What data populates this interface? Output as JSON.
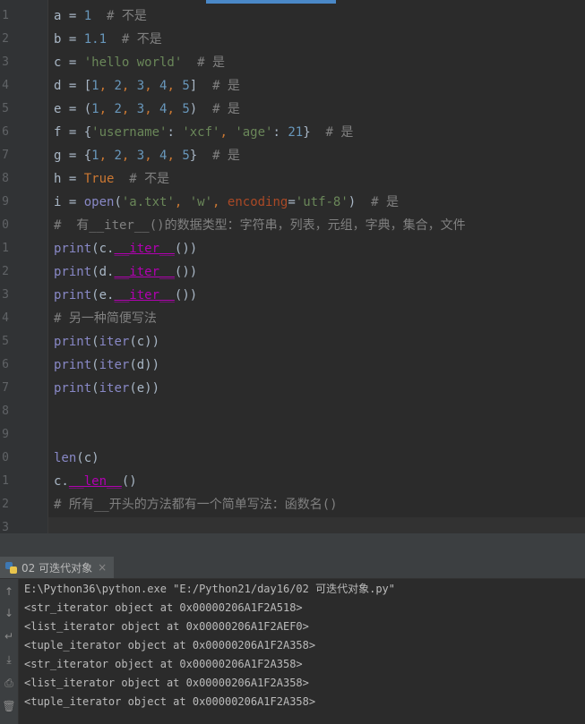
{
  "editor": {
    "lines": [
      {
        "n": "1",
        "segs": [
          {
            "t": "a = ",
            "c": ""
          },
          {
            "t": "1",
            "c": "num"
          },
          {
            "t": "  # 不是",
            "c": "com"
          }
        ]
      },
      {
        "n": "2",
        "segs": [
          {
            "t": "b = ",
            "c": ""
          },
          {
            "t": "1.1",
            "c": "num"
          },
          {
            "t": "  # 不是",
            "c": "com"
          }
        ]
      },
      {
        "n": "3",
        "segs": [
          {
            "t": "c = ",
            "c": ""
          },
          {
            "t": "'hello world'",
            "c": "str"
          },
          {
            "t": "  # 是",
            "c": "com"
          }
        ]
      },
      {
        "n": "4",
        "segs": [
          {
            "t": "d = [",
            "c": ""
          },
          {
            "t": "1",
            "c": "num"
          },
          {
            "t": ", ",
            "c": "kw"
          },
          {
            "t": "2",
            "c": "num"
          },
          {
            "t": ", ",
            "c": "kw"
          },
          {
            "t": "3",
            "c": "num"
          },
          {
            "t": ", ",
            "c": "kw"
          },
          {
            "t": "4",
            "c": "num"
          },
          {
            "t": ", ",
            "c": "kw"
          },
          {
            "t": "5",
            "c": "num"
          },
          {
            "t": "]  ",
            "c": ""
          },
          {
            "t": "# 是",
            "c": "com"
          }
        ]
      },
      {
        "n": "5",
        "segs": [
          {
            "t": "e = (",
            "c": ""
          },
          {
            "t": "1",
            "c": "num"
          },
          {
            "t": ", ",
            "c": "kw"
          },
          {
            "t": "2",
            "c": "num"
          },
          {
            "t": ", ",
            "c": "kw"
          },
          {
            "t": "3",
            "c": "num"
          },
          {
            "t": ", ",
            "c": "kw"
          },
          {
            "t": "4",
            "c": "num"
          },
          {
            "t": ", ",
            "c": "kw"
          },
          {
            "t": "5",
            "c": "num"
          },
          {
            "t": ")  ",
            "c": ""
          },
          {
            "t": "# 是",
            "c": "com"
          }
        ]
      },
      {
        "n": "6",
        "segs": [
          {
            "t": "f = {",
            "c": ""
          },
          {
            "t": "'username'",
            "c": "str"
          },
          {
            "t": ": ",
            "c": ""
          },
          {
            "t": "'xcf'",
            "c": "str"
          },
          {
            "t": ", ",
            "c": "kw"
          },
          {
            "t": "'age'",
            "c": "str"
          },
          {
            "t": ": ",
            "c": ""
          },
          {
            "t": "21",
            "c": "num"
          },
          {
            "t": "}  ",
            "c": ""
          },
          {
            "t": "# 是",
            "c": "com"
          }
        ]
      },
      {
        "n": "7",
        "segs": [
          {
            "t": "g = {",
            "c": ""
          },
          {
            "t": "1",
            "c": "num"
          },
          {
            "t": ", ",
            "c": "kw"
          },
          {
            "t": "2",
            "c": "num"
          },
          {
            "t": ", ",
            "c": "kw"
          },
          {
            "t": "3",
            "c": "num"
          },
          {
            "t": ", ",
            "c": "kw"
          },
          {
            "t": "4",
            "c": "num"
          },
          {
            "t": ", ",
            "c": "kw"
          },
          {
            "t": "5",
            "c": "num"
          },
          {
            "t": "}  ",
            "c": ""
          },
          {
            "t": "# 是",
            "c": "com"
          }
        ]
      },
      {
        "n": "8",
        "segs": [
          {
            "t": "h = ",
            "c": ""
          },
          {
            "t": "True",
            "c": "kw"
          },
          {
            "t": "  # 不是",
            "c": "com"
          }
        ]
      },
      {
        "n": "9",
        "segs": [
          {
            "t": "i = ",
            "c": ""
          },
          {
            "t": "open",
            "c": "bi"
          },
          {
            "t": "(",
            "c": ""
          },
          {
            "t": "'a.txt'",
            "c": "str"
          },
          {
            "t": ", ",
            "c": "kw"
          },
          {
            "t": "'w'",
            "c": "str"
          },
          {
            "t": ", ",
            "c": "kw"
          },
          {
            "t": "encoding",
            "c": "param"
          },
          {
            "t": "=",
            "c": ""
          },
          {
            "t": "'utf-8'",
            "c": "str"
          },
          {
            "t": ")  ",
            "c": ""
          },
          {
            "t": "# 是",
            "c": "com"
          }
        ]
      },
      {
        "n": "0",
        "segs": [
          {
            "t": "#  有__iter__()的数据类型：字符串，列表，元组，字典，集合，文件",
            "c": "com"
          }
        ]
      },
      {
        "n": "1",
        "segs": [
          {
            "t": "print",
            "c": "bi"
          },
          {
            "t": "(c.",
            "c": ""
          },
          {
            "t": "__iter__",
            "c": "dun"
          },
          {
            "t": "())",
            "c": ""
          }
        ]
      },
      {
        "n": "2",
        "segs": [
          {
            "t": "print",
            "c": "bi"
          },
          {
            "t": "(d.",
            "c": ""
          },
          {
            "t": "__iter__",
            "c": "dun"
          },
          {
            "t": "())",
            "c": ""
          }
        ]
      },
      {
        "n": "3",
        "segs": [
          {
            "t": "print",
            "c": "bi"
          },
          {
            "t": "(e.",
            "c": ""
          },
          {
            "t": "__iter__",
            "c": "dun"
          },
          {
            "t": "())",
            "c": ""
          }
        ]
      },
      {
        "n": "4",
        "segs": [
          {
            "t": "# 另一种简便写法",
            "c": "com"
          }
        ]
      },
      {
        "n": "5",
        "segs": [
          {
            "t": "print",
            "c": "bi"
          },
          {
            "t": "(",
            "c": ""
          },
          {
            "t": "iter",
            "c": "bi"
          },
          {
            "t": "(c))",
            "c": ""
          }
        ]
      },
      {
        "n": "6",
        "segs": [
          {
            "t": "print",
            "c": "bi"
          },
          {
            "t": "(",
            "c": ""
          },
          {
            "t": "iter",
            "c": "bi"
          },
          {
            "t": "(d))",
            "c": ""
          }
        ]
      },
      {
        "n": "7",
        "segs": [
          {
            "t": "print",
            "c": "bi"
          },
          {
            "t": "(",
            "c": ""
          },
          {
            "t": "iter",
            "c": "bi"
          },
          {
            "t": "(e))",
            "c": ""
          }
        ]
      },
      {
        "n": "8",
        "segs": []
      },
      {
        "n": "9",
        "segs": []
      },
      {
        "n": "0",
        "segs": [
          {
            "t": "len",
            "c": "bi"
          },
          {
            "t": "(c)",
            "c": ""
          }
        ]
      },
      {
        "n": "1",
        "segs": [
          {
            "t": "c.",
            "c": ""
          },
          {
            "t": "__len__",
            "c": "dun"
          },
          {
            "t": "()",
            "c": ""
          }
        ]
      },
      {
        "n": "2",
        "segs": [
          {
            "t": "# 所有__开头的方法都有一个简单写法：函数名()",
            "c": "com"
          }
        ]
      },
      {
        "n": "3",
        "segs": []
      }
    ]
  },
  "run": {
    "tab_label": "02 可迭代对象",
    "close_icon": "×",
    "toolbar_icons": [
      "↑",
      "↓",
      "↵",
      "⤓",
      "⎙",
      "🗑"
    ],
    "output": [
      "E:\\Python36\\python.exe \"E:/Python21/day16/02 可迭代对象.py\"",
      "<str_iterator object at 0x00000206A1F2A518>",
      "<list_iterator object at 0x00000206A1F2AEF0>",
      "<tuple_iterator object at 0x00000206A1F2A358>",
      "<str_iterator object at 0x00000206A1F2A358>",
      "<list_iterator object at 0x00000206A1F2A358>",
      "<tuple_iterator object at 0x00000206A1F2A358>"
    ]
  }
}
